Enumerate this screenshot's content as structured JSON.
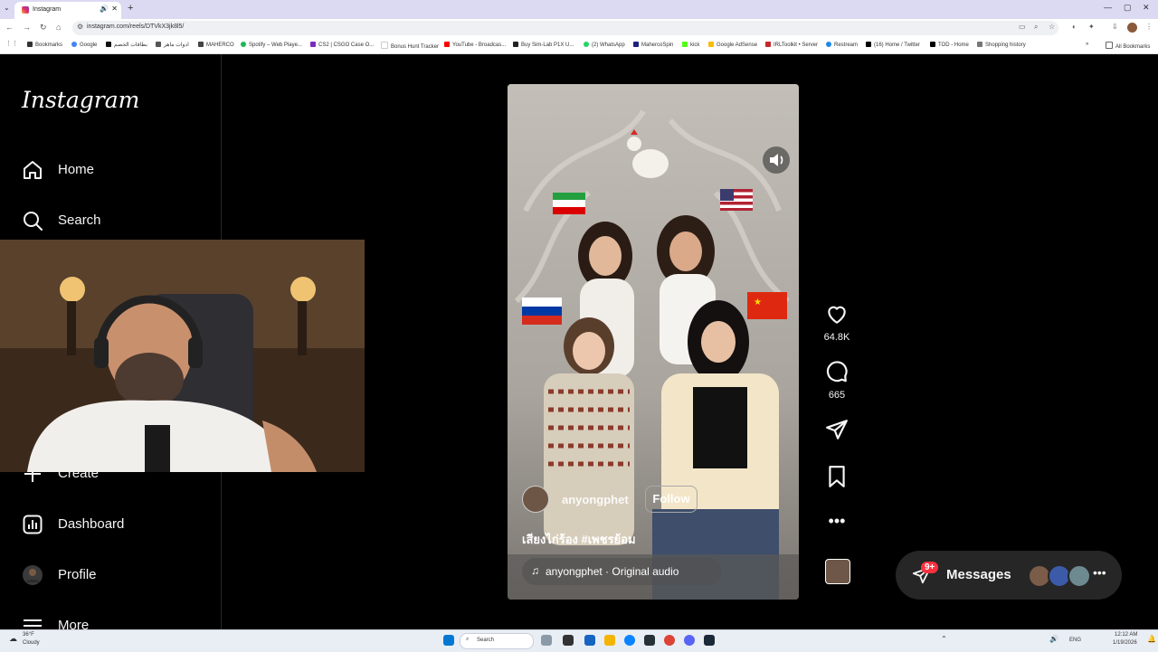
{
  "browser": {
    "tab_title": "Instagram",
    "new_tab": "+",
    "url": "instagram.com/reels/DTVkX3jk8l5/",
    "bookmarks": [
      {
        "label": "Bookmarks",
        "color": "#333333"
      },
      {
        "label": "Google",
        "color": "#4285f4"
      },
      {
        "label": "بطاقات الخصم",
        "color": "#111111"
      },
      {
        "label": "ادوات ماهر",
        "color": "#555555"
      },
      {
        "label": "MAHERCO",
        "color": "#444444"
      },
      {
        "label": "Spotify – Web Playe...",
        "color": "#1db954"
      },
      {
        "label": "CS2 | CSGO Case O...",
        "color": "#7b2cbf"
      },
      {
        "label": "Bonus Hunt Tracker",
        "color": "#ffffff"
      },
      {
        "label": "YouTube - Broadcas...",
        "color": "#ff0000"
      },
      {
        "label": "Buy Sim-Lab P1X U...",
        "color": "#222222"
      },
      {
        "label": "(2) WhatsApp",
        "color": "#25d366"
      },
      {
        "label": "MahercoSpin",
        "color": "#1a237e"
      },
      {
        "label": "kick",
        "color": "#53fc18"
      },
      {
        "label": "Google AdSense",
        "color": "#fbbc05"
      },
      {
        "label": "IRLToolkit • Server",
        "color": "#c62828"
      },
      {
        "label": "Restream",
        "color": "#1e88e5"
      },
      {
        "label": "(16) Home / Twitter",
        "color": "#000000"
      },
      {
        "label": "TOD - Home",
        "color": "#000000"
      },
      {
        "label": "Shopping history",
        "color": "#777777"
      }
    ],
    "all_bookmarks": "All Bookmarks"
  },
  "sidebar": {
    "logo": "Instagram",
    "items": [
      {
        "label": "Home",
        "icon": "home-icon"
      },
      {
        "label": "Search",
        "icon": "search-icon"
      },
      {
        "label": "Create",
        "icon": "plus-icon"
      },
      {
        "label": "Dashboard",
        "icon": "dashboard-icon"
      },
      {
        "label": "Profile",
        "icon": "avatar"
      },
      {
        "label": "More",
        "icon": "menu-icon"
      }
    ]
  },
  "reel": {
    "username": "anyongphet",
    "follow_label": "Follow",
    "caption": "เสียงไก่ร้อง #เพชรย้อม",
    "audio": "anyongphet · Original audio",
    "likes": "64.8K",
    "comments": "665"
  },
  "messages": {
    "label": "Messages",
    "badge": "9+"
  },
  "taskbar": {
    "weather_temp": "36°F",
    "weather_desc": "Cloudy",
    "search": "Search",
    "lang": "ENG",
    "time": "12:12 AM",
    "date": "1/19/2026"
  },
  "colors": {
    "background": "#000000",
    "follow_border": "#a8a8a8",
    "badge": "#ff3040"
  }
}
